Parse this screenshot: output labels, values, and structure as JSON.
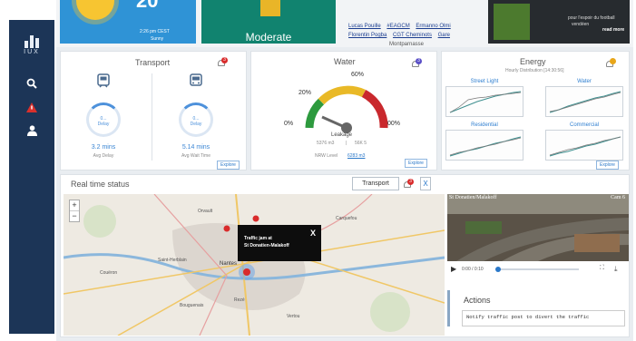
{
  "sidebar": {
    "logo_text": "IUX",
    "items": [
      {
        "icon": "search-icon"
      },
      {
        "icon": "alert-icon"
      },
      {
        "icon": "user-icon"
      }
    ]
  },
  "weather": {
    "temperature": "20",
    "time": "2:26 pm CEST",
    "condition": "Sunny"
  },
  "air_quality": {
    "label": "Moderate",
    "color": "#11836f"
  },
  "news_links": {
    "row1": [
      "Lucas Pouille",
      "#EAGCM",
      "Ermanno Olmi"
    ],
    "row2": [
      "Florentin Pogba",
      "CGT Cheminots",
      "Gare"
    ],
    "location": "Montparnasse"
  },
  "news_card": {
    "line1": "pour l'espoir du football",
    "line2": "vendéen",
    "more": "read more"
  },
  "transport": {
    "title": "Transport",
    "notification_count": "3",
    "avg_delay": {
      "gauge_top": "0...",
      "gauge_bottom": "Delay",
      "value": "3.2 mins",
      "label": "Avg Delay"
    },
    "avg_wait": {
      "gauge_top": "0...",
      "gauge_bottom": "Delay",
      "value": "5.14 mins",
      "label": "Avg Wait Time"
    },
    "explore": "Explore"
  },
  "water": {
    "title": "Water",
    "notification_count": "3",
    "gauge_labels": {
      "p0": "0%",
      "p20": "20%",
      "p60": "60%",
      "p100": "00%"
    },
    "leakage_label": "Leakage",
    "leakage_value": "5376 m3",
    "leakage_pct": "56K 5",
    "nrw_label": "NRW Level",
    "nrw_value": "6283 m3",
    "explore": "Explore"
  },
  "energy": {
    "title": "Energy",
    "subtitle": "Hourly Distribution [14:30:56]",
    "charts": [
      {
        "title": "Street Light"
      },
      {
        "title": "Water"
      },
      {
        "title": "Residential"
      },
      {
        "title": "Commercial"
      }
    ],
    "explore": "Explore"
  },
  "realtime": {
    "title": "Real time status",
    "filter_label": "Transport",
    "notification_count": "3",
    "close_label": "X",
    "zoom_in": "+",
    "zoom_out": "−",
    "popup": {
      "line1": "Traffic jam at",
      "line2": "St Donatien-Malakoff",
      "close": "X"
    },
    "map_labels": [
      "Orvault",
      "Carquefou",
      "Saint-Herblain",
      "Nantes",
      "Couëron",
      "Bouguenais",
      "Rezé",
      "Vertou"
    ]
  },
  "video": {
    "caption_left": "St Donatien/Malakoff",
    "caption_right": "Cam 6",
    "time": "0:00 / 0:10"
  },
  "actions": {
    "title": "Actions",
    "text": "Notify traffic post to divert the traffic"
  }
}
